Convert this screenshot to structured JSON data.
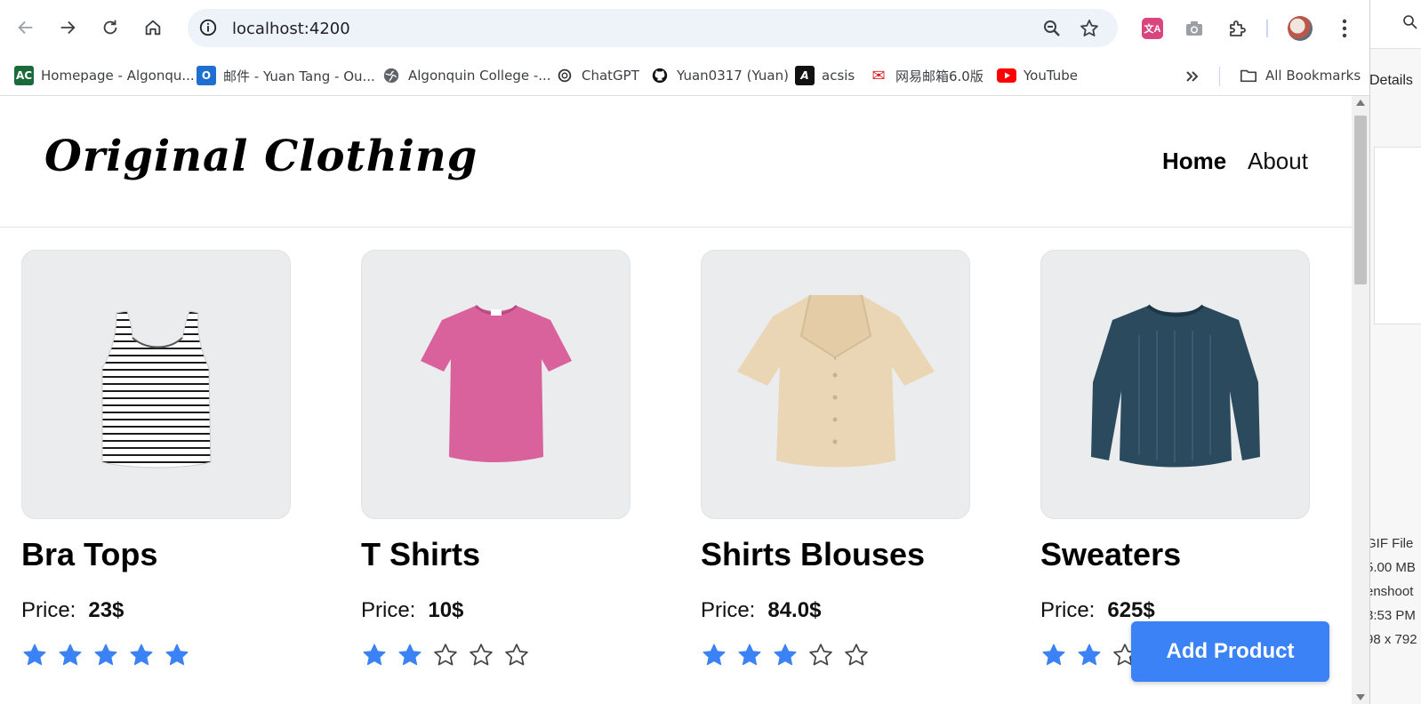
{
  "browser": {
    "url": "localhost:4200",
    "bookmarks": [
      {
        "label": "Homepage - Algonqu...",
        "icon": "algonquin-ac-icon",
        "color": "#1b6b3a"
      },
      {
        "label": "邮件 - Yuan Tang - Ou...",
        "icon": "outlook-icon",
        "color": "#1f6fd1"
      },
      {
        "label": "Algonquin College -...",
        "icon": "globe-icon",
        "color": "#5f6368"
      },
      {
        "label": "ChatGPT",
        "icon": "chatgpt-icon",
        "color": "#333333"
      },
      {
        "label": "Yuan0317 (Yuan)",
        "icon": "github-icon",
        "color": "#111111"
      },
      {
        "label": "acsis",
        "icon": "acsis-icon",
        "color": "#111111"
      },
      {
        "label": "网易邮箱6.0版",
        "icon": "netease-mail-icon",
        "color": "#d9252b"
      },
      {
        "label": "YouTube",
        "icon": "youtube-icon",
        "color": "#ff0000"
      }
    ],
    "all_bookmarks_label": "All Bookmarks"
  },
  "site": {
    "logo": "Original Clothing",
    "nav": {
      "home": "Home",
      "about": "About"
    }
  },
  "products": [
    {
      "title": "Bra Tops",
      "price_label": "Price:",
      "price": "23$",
      "rating": 5,
      "garment": "striped tank top"
    },
    {
      "title": "T Shirts",
      "price_label": "Price:",
      "price": "10$",
      "rating": 2,
      "garment": "pink t-shirt"
    },
    {
      "title": "Shirts Blouses",
      "price_label": "Price:",
      "price": "84.0$",
      "rating": 3,
      "garment": "beige blouse"
    },
    {
      "title": "Sweaters",
      "price_label": "Price:",
      "price": "625$",
      "rating": 2,
      "garment": "navy sweater"
    }
  ],
  "actions": {
    "add_product": "Add Product"
  },
  "background_window": {
    "details": "Details",
    "meta": [
      "GIF File",
      "5.00 MB",
      "enshoot",
      "3:53 PM",
      "98 x 792"
    ]
  },
  "colors": {
    "accent": "#3b82f6",
    "star_filled": "#3b82f6",
    "card_bg": "#ebecee"
  }
}
